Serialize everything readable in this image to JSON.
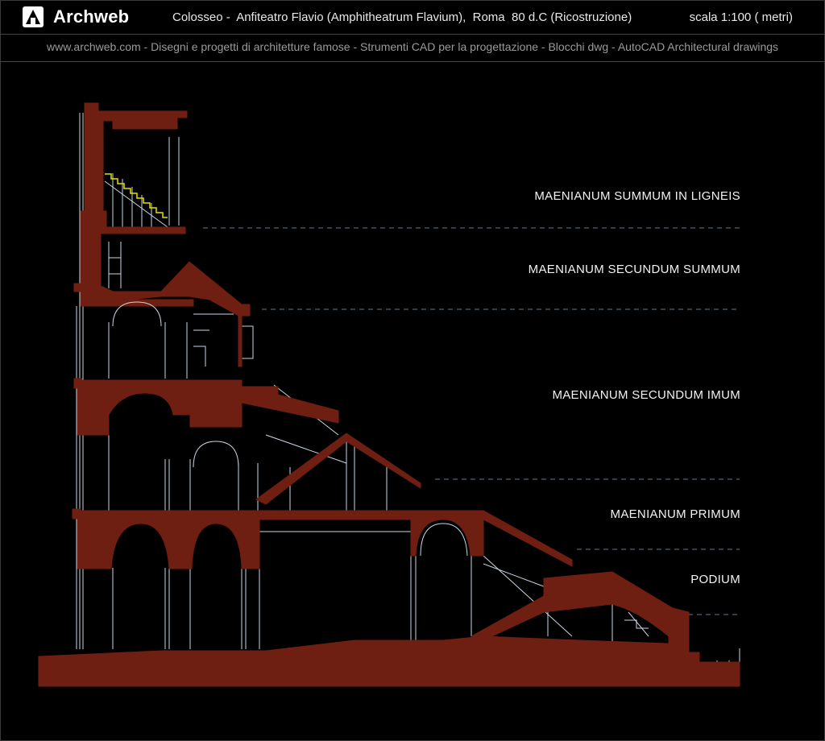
{
  "header": {
    "brand": "Archweb",
    "title": "Colosseo -  Anfiteatro Flavio (Amphitheatrum Flavium),  Roma  80 d.C (Ricostruzione)",
    "scale": "scala 1:100 ( metri)",
    "subtitle": "www.archweb.com - Disegni e progetti di architetture famose - Strumenti CAD  per la progettazione - Blocchi dwg - AutoCAD Architectural drawings"
  },
  "levels": [
    "MAENIANUM SUMMUM IN LIGNEIS",
    "MAENIANUM SECUNDUM SUMMUM",
    "MAENIANUM SECUNDUM IMUM",
    "MAENIANUM PRIMUM",
    "PODIUM"
  ],
  "colors": {
    "section_fill": "#6e1f12",
    "line": "#c9d6e3",
    "level_line": "#5e7c95",
    "stair_timber": "#e6e000"
  }
}
